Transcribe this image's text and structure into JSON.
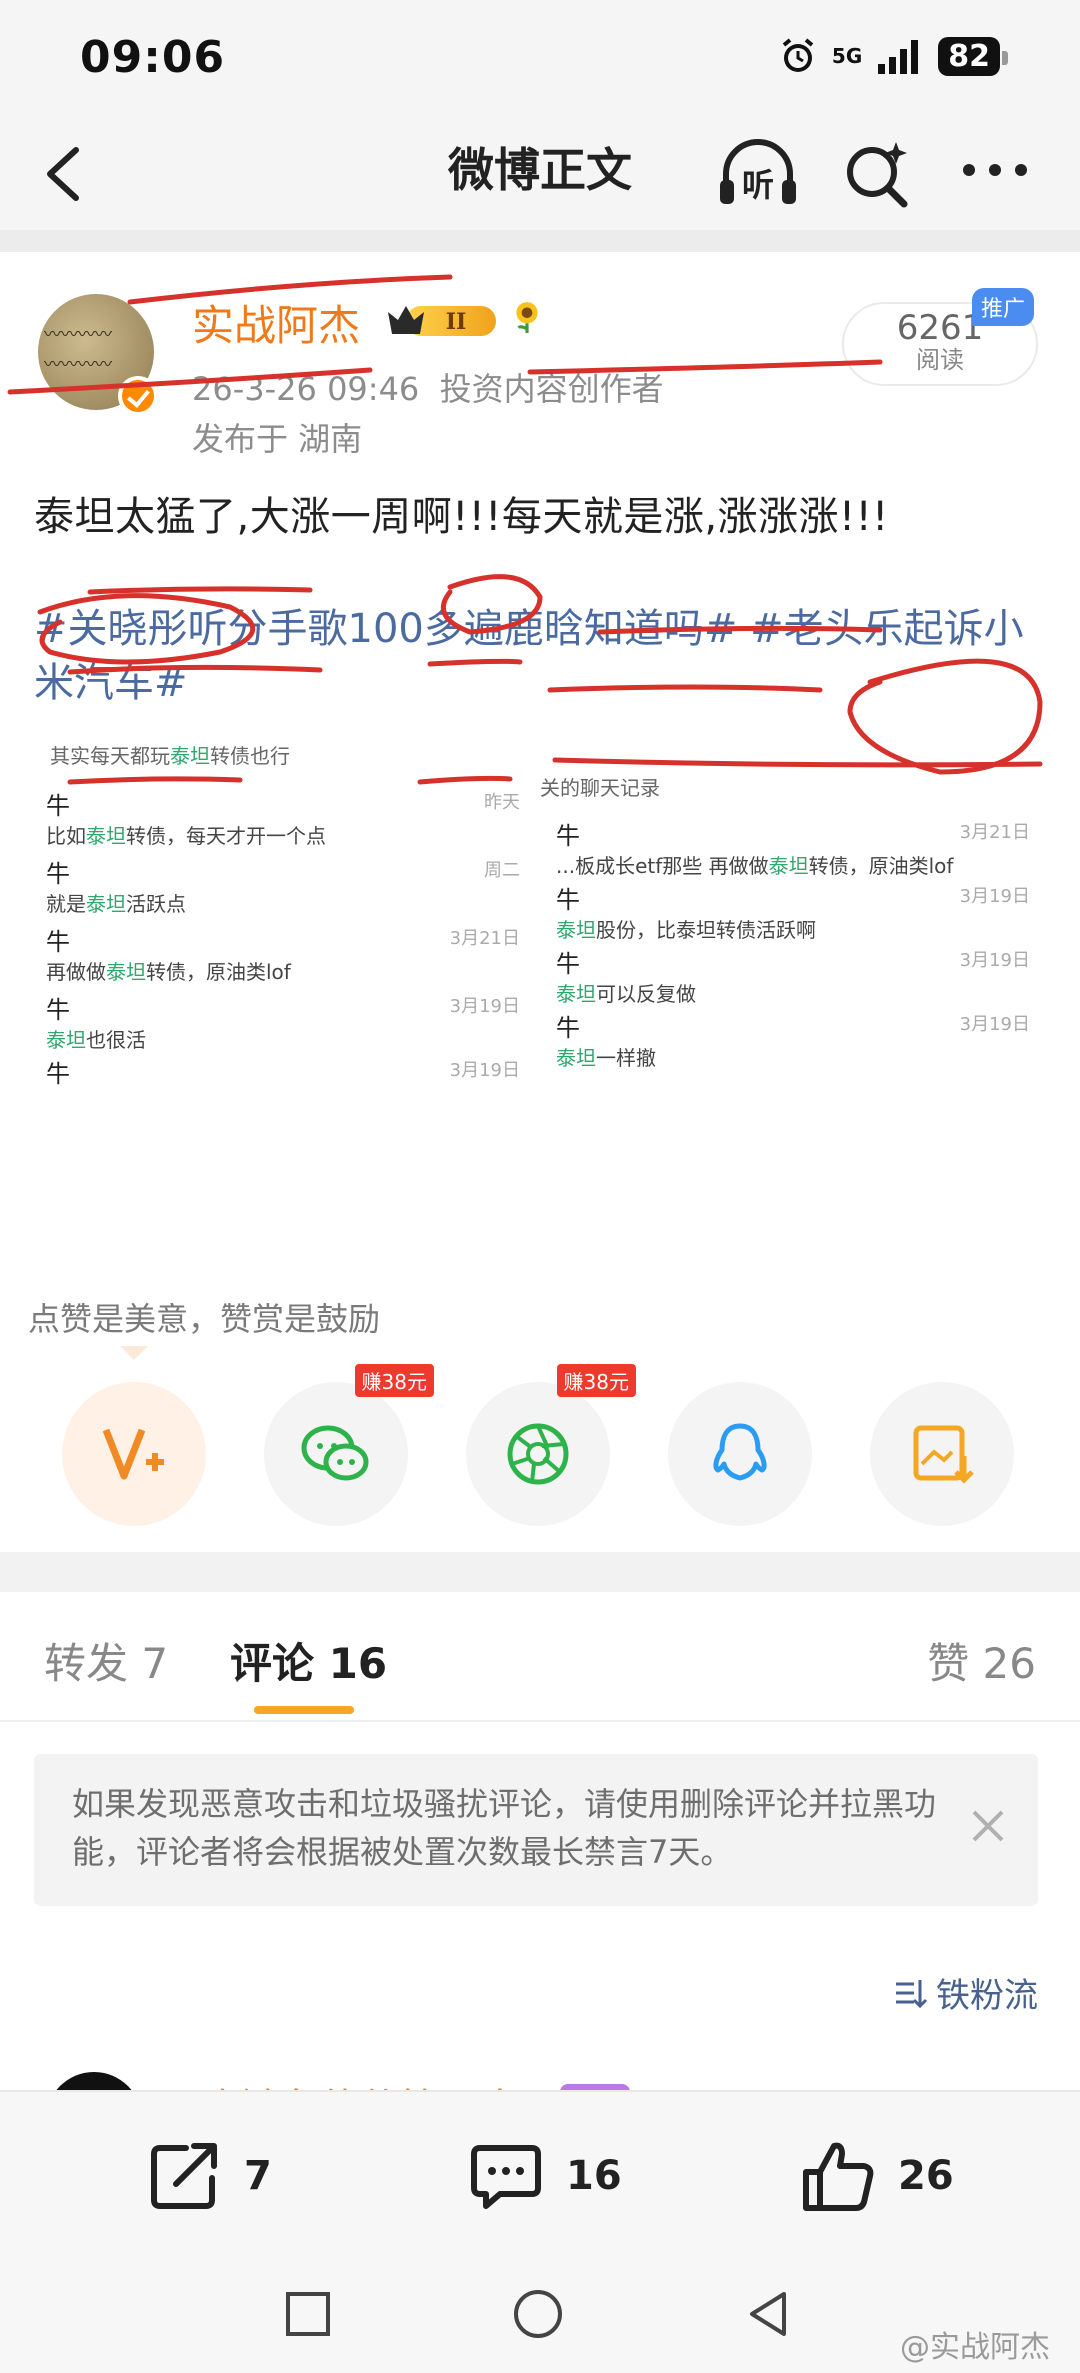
{
  "status_bar": {
    "time": "09:06",
    "network": "5G",
    "battery": "82"
  },
  "nav": {
    "title": "微博正文",
    "listen_label": "听"
  },
  "post": {
    "author": "实战阿杰",
    "level_badge": "II",
    "timestamp": "26-3-26 09:46",
    "author_title": "投资内容创作者",
    "location": "发布于 湖南",
    "read_count": "6261",
    "read_label": "阅读",
    "promo_tag": "推广",
    "text": "泰坦太猛了,大涨一周啊!!!每天就是涨,涨涨涨!!!",
    "hashtags": "#关晓彤听分手歌100多遍鹿晗知道吗# #老头乐起诉小米汽车#",
    "screenshot_left": {
      "caption_prefix": "其实每天都玩",
      "caption_highlight": "泰坦",
      "caption_suffix": "转债也行",
      "rows": [
        {
          "sender": "牛",
          "date": "昨天",
          "pre": "比如",
          "hl": "泰坦",
          "post": "转债，每天才开一个点"
        },
        {
          "sender": "牛",
          "date": "周二",
          "pre": "就是",
          "hl": "泰坦",
          "post": "活跃点"
        },
        {
          "sender": "牛",
          "date": "3月21日",
          "pre": "再做做",
          "hl": "泰坦",
          "post": "转债，原油类lof"
        },
        {
          "sender": "牛",
          "date": "3月19日",
          "pre": "",
          "hl": "泰坦",
          "post": "也很活"
        },
        {
          "sender": "牛",
          "date": "3月19日",
          "pre": "",
          "hl": "",
          "post": ""
        }
      ]
    },
    "screenshot_right": {
      "caption": "关的聊天记录",
      "rows": [
        {
          "sender": "牛",
          "date": "3月21日",
          "pre": "...板成长etf那些  再做做",
          "hl": "泰坦",
          "post": "转债，原油类lof"
        },
        {
          "sender": "牛",
          "date": "3月19日",
          "pre": "",
          "hl": "泰坦",
          "post": "股份，比泰坦转债活跃啊"
        },
        {
          "sender": "牛",
          "date": "3月19日",
          "pre": "",
          "hl": "泰坦",
          "post": "可以反复做"
        },
        {
          "sender": "牛",
          "date": "3月19日",
          "pre": "",
          "hl": "泰坦",
          "post": "一样撤"
        }
      ]
    },
    "tip": "点赞是美意，赞赏是鼓励",
    "share": {
      "earn_wechat": "赚38元",
      "earn_moments": "赚38元"
    }
  },
  "tabs": {
    "repost": "转发 7",
    "comments": "评论 16",
    "likes": "赞 26"
  },
  "notice": "如果发现恶意攻击和垃圾骚扰评论，请使用删除评论并拉黑功能，评论者将会根据被处置次数最长禁言7天。",
  "sort_label": "铁粉流",
  "peek_comment_name": "咋链条软件管理人",
  "action_bar": {
    "repost_count": "7",
    "comment_count": "16",
    "like_count": "26"
  },
  "watermark": "@实战阿杰",
  "colors": {
    "accent_orange": "#f07a1a",
    "link_blue": "#4b6ba0",
    "highlight_green": "#2ea86d",
    "mark_red": "#d6312a",
    "indicator": "#f5a623"
  }
}
